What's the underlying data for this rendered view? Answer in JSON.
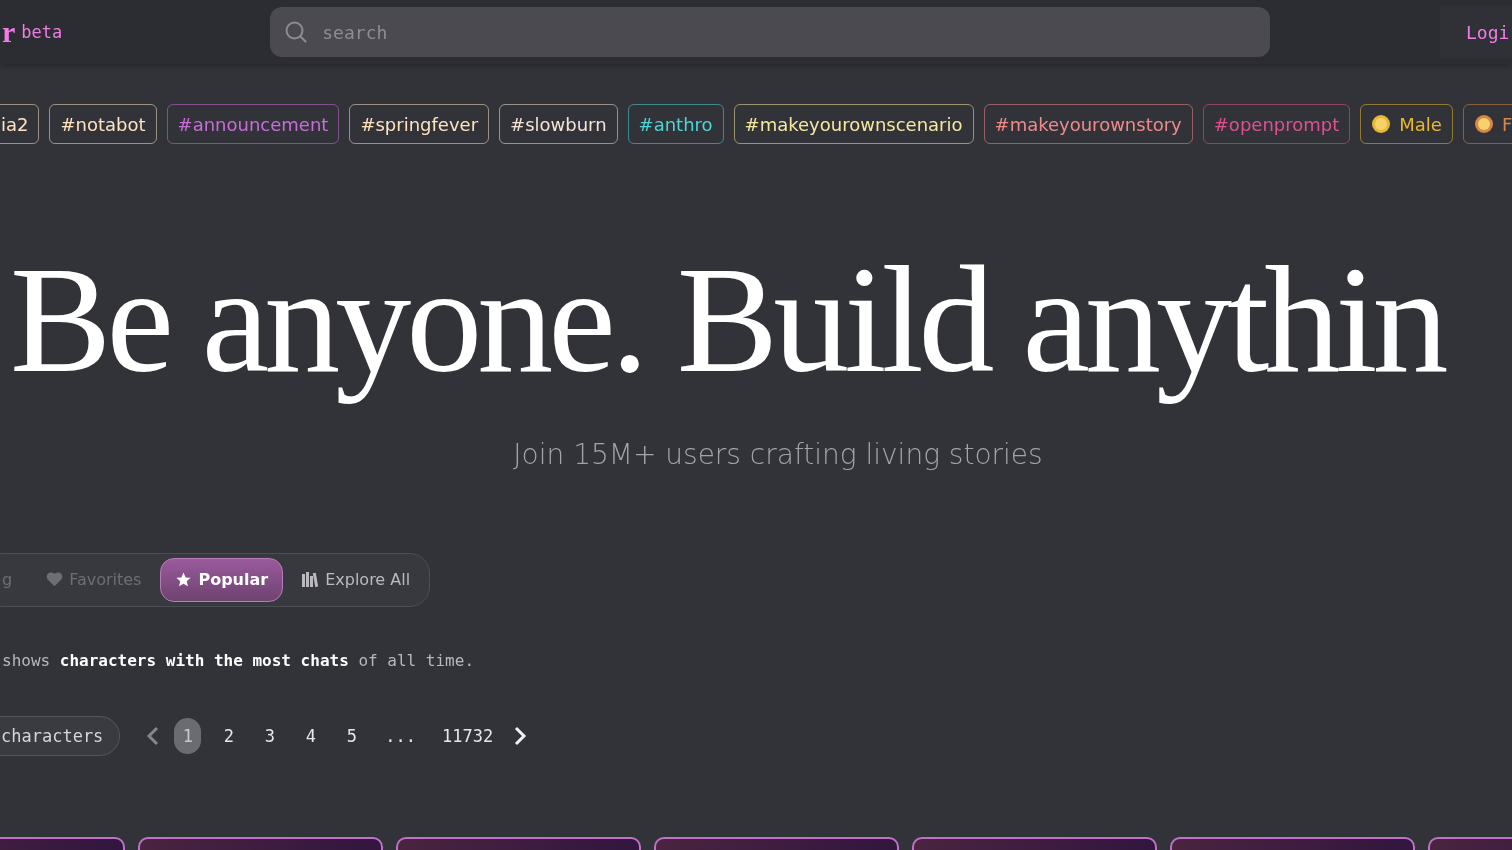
{
  "header": {
    "logo": "r",
    "badge": "beta",
    "search": {
      "placeholder": "search"
    },
    "login": "Logi"
  },
  "tags": [
    {
      "kind": "hashtag",
      "label": "ia2",
      "color": "#fde3c0"
    },
    {
      "kind": "hashtag",
      "label": "#notabot",
      "color": "#fde3c0"
    },
    {
      "kind": "hashtag",
      "label": "#announcement",
      "color": "#c86cd8"
    },
    {
      "kind": "hashtag",
      "label": "#springfever",
      "color": "#fde3c0"
    },
    {
      "kind": "hashtag",
      "label": "#slowburn",
      "color": "#f3e4d6"
    },
    {
      "kind": "hashtag",
      "label": "#anthro",
      "color": "#4dd6d6"
    },
    {
      "kind": "hashtag",
      "label": "#makeyourownscenario",
      "color": "#f5e9a0"
    },
    {
      "kind": "hashtag",
      "label": "#makeyourownstory",
      "color": "#f08a8a"
    },
    {
      "kind": "hashtag",
      "label": "#openprompt",
      "color": "#e0508f"
    },
    {
      "kind": "emoji",
      "label": "Male",
      "color": "#e8b830"
    },
    {
      "kind": "emoji",
      "label": "F",
      "color": "#d6874a"
    }
  ],
  "hero": {
    "title": "Be anyone. Build anythin",
    "subtitle": "Join 15M+ users crafting living stories"
  },
  "tabs": [
    {
      "label": "g",
      "selected": false,
      "disabled": true
    },
    {
      "label": "Favorites",
      "selected": false,
      "disabled": true
    },
    {
      "label": "Popular",
      "selected": true,
      "disabled": false
    },
    {
      "label": "Explore All",
      "selected": false,
      "disabled": false
    }
  ],
  "description": "shows **characters with the most chats** of all time.",
  "filter_button": "characters",
  "pagination": {
    "pages": [
      {
        "label": "1",
        "selected": true
      },
      {
        "label": "2",
        "selected": false
      },
      {
        "label": "3",
        "selected": false
      },
      {
        "label": "4",
        "selected": false
      },
      {
        "label": "5",
        "selected": false
      },
      {
        "label": "...",
        "selected": false
      },
      {
        "label": "11732",
        "selected": false
      }
    ]
  },
  "cards": [
    {
      "kind": "card"
    },
    {
      "kind": "card"
    },
    {
      "kind": "card"
    },
    {
      "kind": "card"
    },
    {
      "kind": "card"
    },
    {
      "kind": "card"
    },
    {
      "kind": "card"
    }
  ]
}
